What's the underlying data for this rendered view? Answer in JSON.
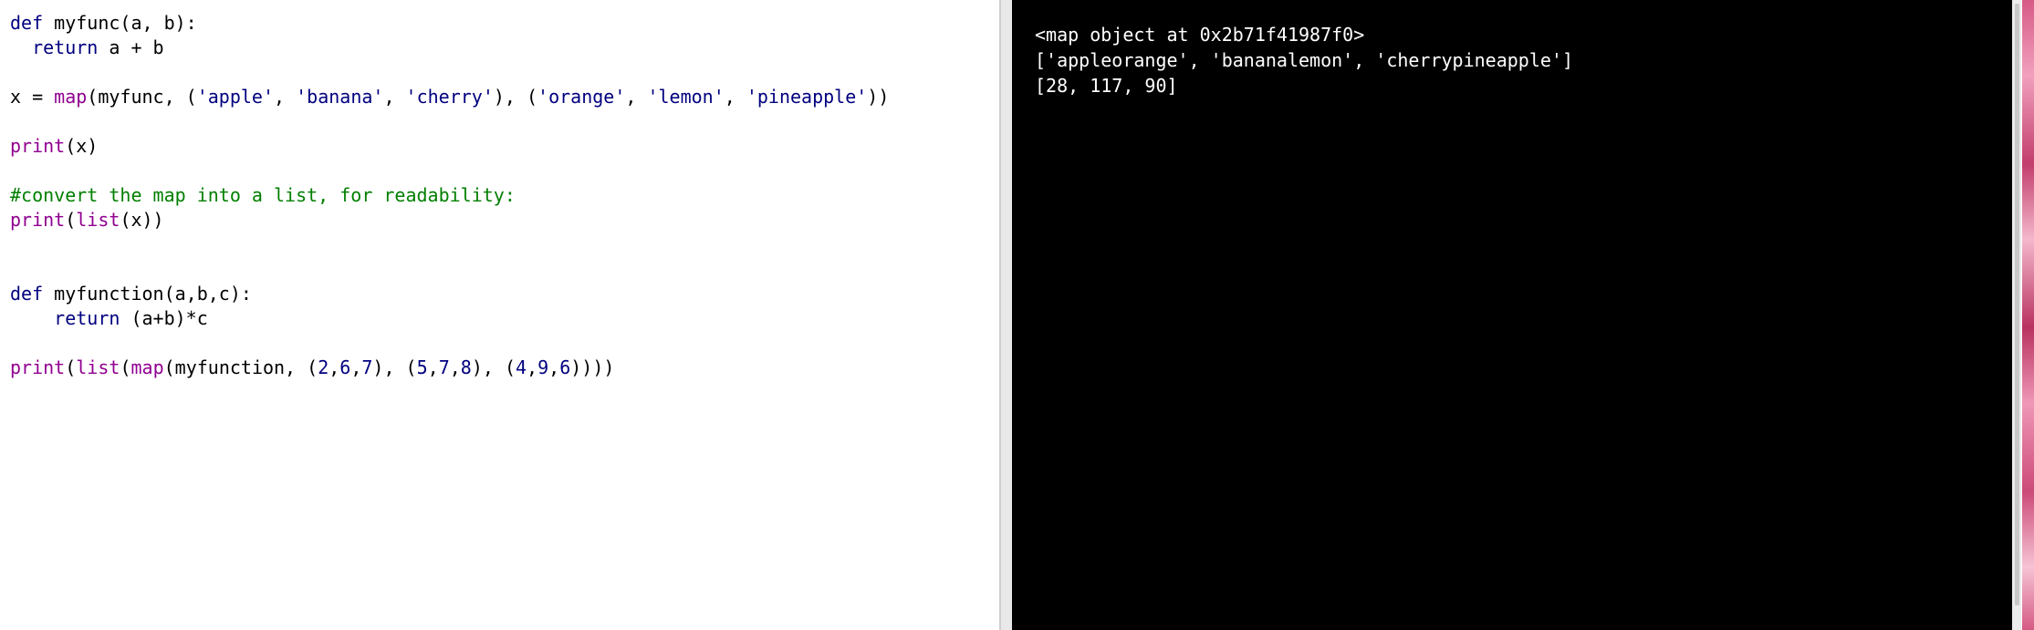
{
  "colors": {
    "keyword": "#00007f",
    "builtin": "#900090",
    "string": "#00007f",
    "comment": "#007f00",
    "default": "#000000",
    "output_bg": "#000000",
    "output_fg": "#ffffff"
  },
  "editor": {
    "lines": [
      [
        {
          "t": "def",
          "c": "keyword"
        },
        {
          "t": " myfunc(a, b):"
        }
      ],
      [
        {
          "t": "  "
        },
        {
          "t": "return",
          "c": "keyword"
        },
        {
          "t": " a + b"
        }
      ],
      [],
      [
        {
          "t": "x = "
        },
        {
          "t": "map",
          "c": "builtin"
        },
        {
          "t": "(myfunc, ("
        },
        {
          "t": "'apple'",
          "c": "string"
        },
        {
          "t": ", "
        },
        {
          "t": "'banana'",
          "c": "string"
        },
        {
          "t": ", "
        },
        {
          "t": "'cherry'",
          "c": "string"
        },
        {
          "t": "), ("
        },
        {
          "t": "'orange'",
          "c": "string"
        },
        {
          "t": ", "
        },
        {
          "t": "'lemon'",
          "c": "string"
        },
        {
          "t": ", "
        },
        {
          "t": "'pineapple'",
          "c": "string"
        },
        {
          "t": "))"
        }
      ],
      [],
      [
        {
          "t": "print",
          "c": "builtin"
        },
        {
          "t": "(x)"
        }
      ],
      [],
      [
        {
          "t": "#convert the map into a list, for readability:",
          "c": "comment"
        }
      ],
      [
        {
          "t": "print",
          "c": "builtin"
        },
        {
          "t": "("
        },
        {
          "t": "list",
          "c": "builtin"
        },
        {
          "t": "(x))"
        }
      ],
      [],
      [],
      [
        {
          "t": "def",
          "c": "keyword"
        },
        {
          "t": " myfunction(a,b,c):"
        }
      ],
      [
        {
          "t": "    "
        },
        {
          "t": "return",
          "c": "keyword"
        },
        {
          "t": " (a+b)*c"
        }
      ],
      [],
      [
        {
          "t": "print",
          "c": "builtin"
        },
        {
          "t": "("
        },
        {
          "t": "list",
          "c": "builtin"
        },
        {
          "t": "("
        },
        {
          "t": "map",
          "c": "builtin"
        },
        {
          "t": "(myfunction, ("
        },
        {
          "t": "2",
          "c": "string"
        },
        {
          "t": ","
        },
        {
          "t": "6",
          "c": "string"
        },
        {
          "t": ","
        },
        {
          "t": "7",
          "c": "string"
        },
        {
          "t": "), ("
        },
        {
          "t": "5",
          "c": "string"
        },
        {
          "t": ","
        },
        {
          "t": "7",
          "c": "string"
        },
        {
          "t": ","
        },
        {
          "t": "8",
          "c": "string"
        },
        {
          "t": "), ("
        },
        {
          "t": "4",
          "c": "string"
        },
        {
          "t": ","
        },
        {
          "t": "9",
          "c": "string"
        },
        {
          "t": ","
        },
        {
          "t": "6",
          "c": "string"
        },
        {
          "t": "))))"
        }
      ]
    ]
  },
  "output": {
    "lines": [
      "<map object at 0x2b71f41987f0>",
      "['appleorange', 'bananalemon', 'cherrypineapple']",
      "[28, 117, 90]"
    ]
  }
}
